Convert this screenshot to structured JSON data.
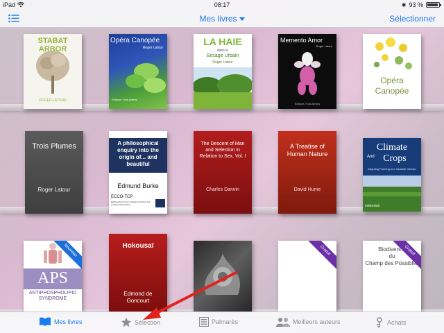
{
  "status_bar": {
    "device": "iPad",
    "time": "08:17",
    "battery": "93 %",
    "battery_level": 0.93
  },
  "nav": {
    "title": "Mes livres",
    "select_label": "Sélectionner"
  },
  "books": {
    "stabat": {
      "title": "STABAT ARBOR",
      "author": "ROGER LATOUR"
    },
    "opera1": {
      "title": "Opéra Canopée",
      "author": "Roger Latour",
      "publisher": "Éditions Trois Arbres"
    },
    "lahaie": {
      "title": "LA HAIE",
      "subtitle": "dans le",
      "subtitle2": "Bocage Urbain",
      "author": "Roger Latour"
    },
    "memento": {
      "title": "Memento Amor",
      "author": "Roger Latour",
      "publisher": "Éditions Trois Arbres"
    },
    "opera2": {
      "title": "Opéra",
      "title2": "Canopée"
    },
    "troisplumes": {
      "title": "Trois Plumes",
      "author": "Roger Latour"
    },
    "burke": {
      "title": "A philosophical enquiry into the origin of... and beautiful",
      "author": "Edmund Burke",
      "series": "ECCO-TCP",
      "series_sub": "Eighteenth Century Collections Online Text Creation Partnership"
    },
    "darwin": {
      "title": "The Descent of Man and Selection in Relation to Sex, Vol. I",
      "author": "Charles Darwin"
    },
    "hume": {
      "title": "A Treatise of Human Nature",
      "author": "David Hume"
    },
    "climate": {
      "title": "Climate",
      "title2": "And",
      "title3": "Crops",
      "subtitle": "Adapting Farming to a Variable Climate",
      "logo": "extension"
    },
    "aps": {
      "title": "APS",
      "subtitle": "ANTIPHOSPHOLIPID SYNDROME",
      "ribbon": "Nouveau"
    },
    "hokousai": {
      "title": "Hokousaï",
      "author": "Edmond de Goncourt"
    },
    "blank": {
      "ribbon": "Gratuit"
    },
    "biodiv": {
      "title": "Biodivers...",
      "line2": "du",
      "line3": "Champ des Possibles",
      "ribbon": "Gratuit"
    }
  },
  "tabs": {
    "mes_livres": "Mes livres",
    "selection": "Sélection",
    "palmares": "Palmarès",
    "meilleurs_auteurs": "Meilleurs auteurs",
    "achats": "Achats"
  },
  "colors": {
    "accent": "#1a7cf2",
    "inactive": "#8e8e93",
    "arrow": "#e0241b"
  }
}
